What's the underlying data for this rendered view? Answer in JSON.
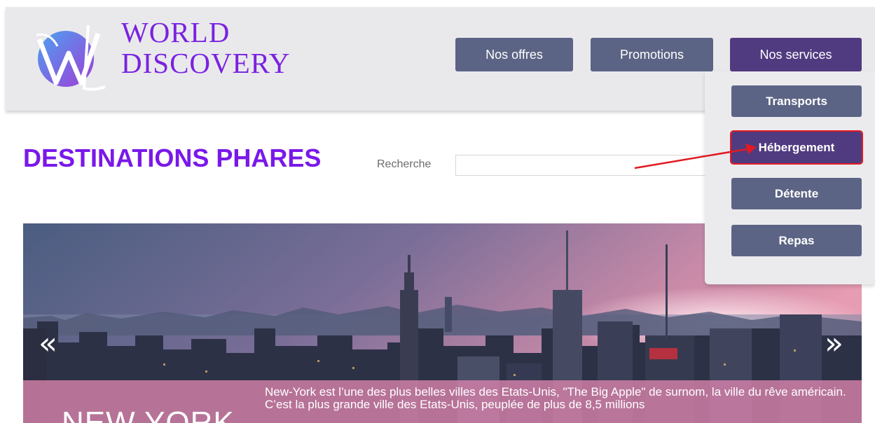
{
  "header": {
    "brand_line1": "WORLD",
    "brand_line2": "DISCOVERY",
    "nav": [
      {
        "label": "Nos offres"
      },
      {
        "label": "Promotions"
      },
      {
        "label": "Nos services"
      }
    ]
  },
  "services_menu": {
    "items": [
      {
        "label": "Transports"
      },
      {
        "label": "Hébergement",
        "highlighted": true
      },
      {
        "label": "Détente"
      },
      {
        "label": "Repas"
      }
    ]
  },
  "main": {
    "section_title": "DESTINATIONS PHARES",
    "search": {
      "label": "Recherche",
      "value": "",
      "placeholder": ""
    }
  },
  "carousel": {
    "prev_icon": "chevron-left-icon",
    "next_icon": "chevron-right-icon",
    "slide": {
      "title": "NEW YORK",
      "text": "New-York est l’une des plus belles villes des Etats-Unis, \"The Big Apple\" de surnom, la ville du rêve américain. C’est la plus grande ville des Etats-Unis, peuplée de plus de 8,5 millions"
    }
  },
  "colors": {
    "brand_purple": "#7a22e0",
    "nav_button": "#5c6485",
    "nav_active": "#513b80",
    "annotation_red": "#e11a22",
    "caption_pink": "#d681aa"
  }
}
